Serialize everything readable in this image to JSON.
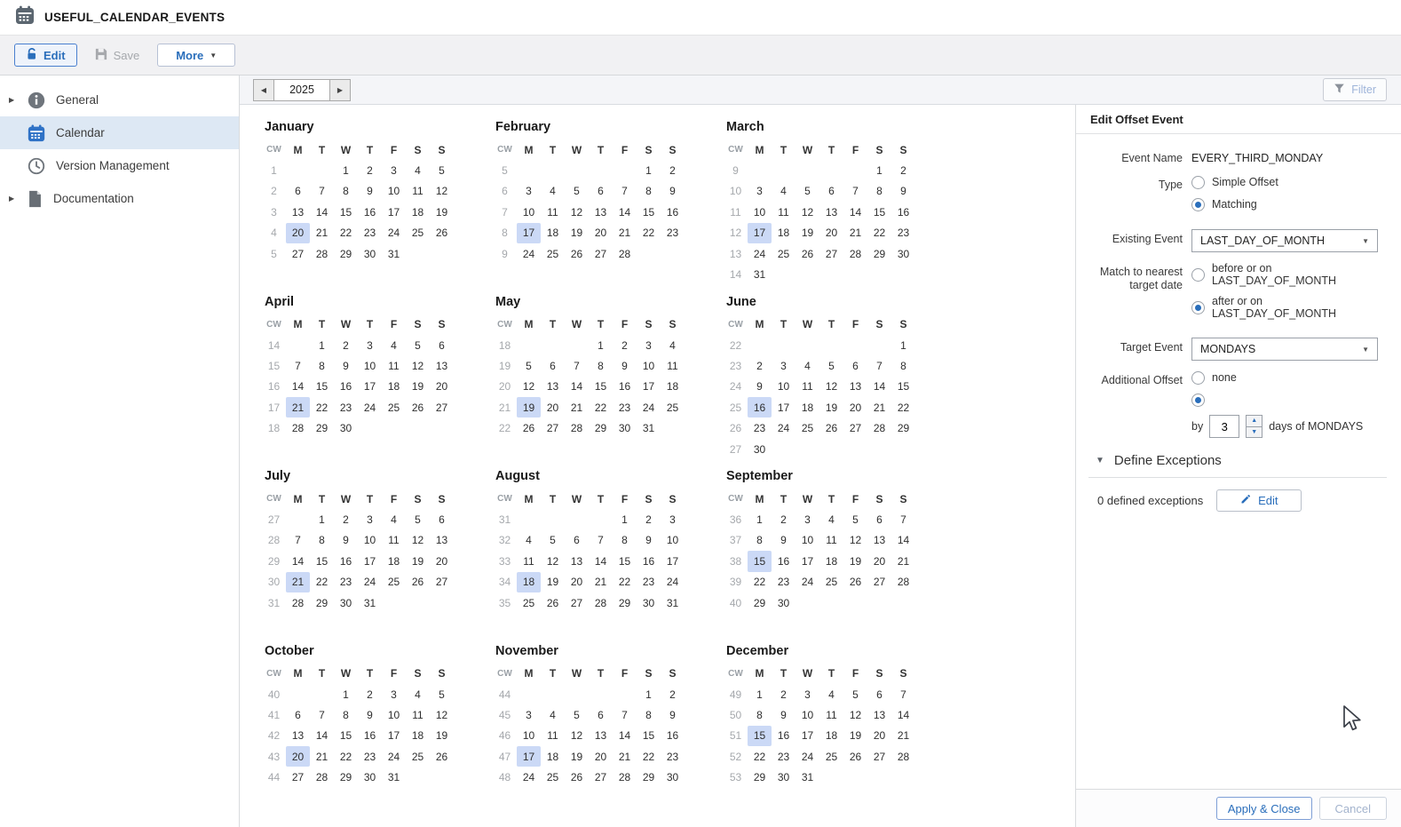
{
  "colors": {
    "accent": "#2a6ebb",
    "accent_border": "#4a80cf",
    "highlight": "#cbd9f6",
    "sidebar_selected": "#dde8f4"
  },
  "header": {
    "title": "USEFUL_CALENDAR_EVENTS"
  },
  "toolbar": {
    "edit": "Edit",
    "save": "Save",
    "more": "More"
  },
  "sidebar": {
    "items": [
      {
        "label": "General",
        "icon": "info-icon",
        "chevron": true,
        "selected": false
      },
      {
        "label": "Calendar",
        "icon": "calendar-icon",
        "chevron": false,
        "selected": true
      },
      {
        "label": "Version Management",
        "icon": "clock-icon",
        "chevron": false,
        "selected": false
      },
      {
        "label": "Documentation",
        "icon": "doc-icon",
        "chevron": true,
        "selected": false
      }
    ]
  },
  "main": {
    "year": "2025",
    "filter": "Filter"
  },
  "calendar": {
    "weekdays": [
      "CW",
      "M",
      "T",
      "W",
      "T",
      "F",
      "S",
      "S"
    ],
    "months": [
      {
        "name": "January",
        "highlight": 20,
        "weeks": [
          {
            "cw": 1,
            "days": [
              "",
              "",
              1,
              2,
              3,
              4,
              5
            ]
          },
          {
            "cw": 2,
            "days": [
              6,
              7,
              8,
              9,
              10,
              11,
              12
            ]
          },
          {
            "cw": 3,
            "days": [
              13,
              14,
              15,
              16,
              17,
              18,
              19
            ]
          },
          {
            "cw": 4,
            "days": [
              20,
              21,
              22,
              23,
              24,
              25,
              26
            ]
          },
          {
            "cw": 5,
            "days": [
              27,
              28,
              29,
              30,
              31,
              "",
              ""
            ]
          }
        ]
      },
      {
        "name": "February",
        "highlight": 17,
        "weeks": [
          {
            "cw": 5,
            "days": [
              "",
              "",
              "",
              "",
              "",
              1,
              2
            ]
          },
          {
            "cw": 6,
            "days": [
              3,
              4,
              5,
              6,
              7,
              8,
              9
            ]
          },
          {
            "cw": 7,
            "days": [
              10,
              11,
              12,
              13,
              14,
              15,
              16
            ]
          },
          {
            "cw": 8,
            "days": [
              17,
              18,
              19,
              20,
              21,
              22,
              23
            ]
          },
          {
            "cw": 9,
            "days": [
              24,
              25,
              26,
              27,
              28,
              "",
              ""
            ]
          }
        ]
      },
      {
        "name": "March",
        "highlight": 17,
        "weeks": [
          {
            "cw": 9,
            "days": [
              "",
              "",
              "",
              "",
              "",
              1,
              2
            ]
          },
          {
            "cw": 10,
            "days": [
              3,
              4,
              5,
              6,
              7,
              8,
              9
            ]
          },
          {
            "cw": 11,
            "days": [
              10,
              11,
              12,
              13,
              14,
              15,
              16
            ]
          },
          {
            "cw": 12,
            "days": [
              17,
              18,
              19,
              20,
              21,
              22,
              23
            ]
          },
          {
            "cw": 13,
            "days": [
              24,
              25,
              26,
              27,
              28,
              29,
              30
            ]
          },
          {
            "cw": 14,
            "days": [
              31,
              "",
              "",
              "",
              "",
              "",
              ""
            ]
          }
        ]
      },
      {
        "name": "April",
        "highlight": 21,
        "weeks": [
          {
            "cw": 14,
            "days": [
              "",
              1,
              2,
              3,
              4,
              5,
              6
            ]
          },
          {
            "cw": 15,
            "days": [
              7,
              8,
              9,
              10,
              11,
              12,
              13
            ]
          },
          {
            "cw": 16,
            "days": [
              14,
              15,
              16,
              17,
              18,
              19,
              20
            ]
          },
          {
            "cw": 17,
            "days": [
              21,
              22,
              23,
              24,
              25,
              26,
              27
            ]
          },
          {
            "cw": 18,
            "days": [
              28,
              29,
              30,
              "",
              "",
              "",
              ""
            ]
          }
        ]
      },
      {
        "name": "May",
        "highlight": 19,
        "weeks": [
          {
            "cw": 18,
            "days": [
              "",
              "",
              "",
              1,
              2,
              3,
              4
            ]
          },
          {
            "cw": 19,
            "days": [
              5,
              6,
              7,
              8,
              9,
              10,
              11
            ]
          },
          {
            "cw": 20,
            "days": [
              12,
              13,
              14,
              15,
              16,
              17,
              18
            ]
          },
          {
            "cw": 21,
            "days": [
              19,
              20,
              21,
              22,
              23,
              24,
              25
            ]
          },
          {
            "cw": 22,
            "days": [
              26,
              27,
              28,
              29,
              30,
              31,
              ""
            ]
          }
        ]
      },
      {
        "name": "June",
        "highlight": 16,
        "weeks": [
          {
            "cw": 22,
            "days": [
              "",
              "",
              "",
              "",
              "",
              "",
              1
            ]
          },
          {
            "cw": 23,
            "days": [
              2,
              3,
              4,
              5,
              6,
              7,
              8
            ]
          },
          {
            "cw": 24,
            "days": [
              9,
              10,
              11,
              12,
              13,
              14,
              15
            ]
          },
          {
            "cw": 25,
            "days": [
              16,
              17,
              18,
              19,
              20,
              21,
              22
            ]
          },
          {
            "cw": 26,
            "days": [
              23,
              24,
              25,
              26,
              27,
              28,
              29
            ]
          },
          {
            "cw": 27,
            "days": [
              30,
              "",
              "",
              "",
              "",
              "",
              ""
            ]
          }
        ]
      },
      {
        "name": "July",
        "highlight": 21,
        "weeks": [
          {
            "cw": 27,
            "days": [
              "",
              1,
              2,
              3,
              4,
              5,
              6
            ]
          },
          {
            "cw": 28,
            "days": [
              7,
              8,
              9,
              10,
              11,
              12,
              13
            ]
          },
          {
            "cw": 29,
            "days": [
              14,
              15,
              16,
              17,
              18,
              19,
              20
            ]
          },
          {
            "cw": 30,
            "days": [
              21,
              22,
              23,
              24,
              25,
              26,
              27
            ]
          },
          {
            "cw": 31,
            "days": [
              28,
              29,
              30,
              31,
              "",
              "",
              ""
            ]
          }
        ]
      },
      {
        "name": "August",
        "highlight": 18,
        "weeks": [
          {
            "cw": 31,
            "days": [
              "",
              "",
              "",
              "",
              1,
              2,
              3
            ]
          },
          {
            "cw": 32,
            "days": [
              4,
              5,
              6,
              7,
              8,
              9,
              10
            ]
          },
          {
            "cw": 33,
            "days": [
              11,
              12,
              13,
              14,
              15,
              16,
              17
            ]
          },
          {
            "cw": 34,
            "days": [
              18,
              19,
              20,
              21,
              22,
              23,
              24
            ]
          },
          {
            "cw": 35,
            "days": [
              25,
              26,
              27,
              28,
              29,
              30,
              31
            ]
          }
        ]
      },
      {
        "name": "September",
        "highlight": 15,
        "weeks": [
          {
            "cw": 36,
            "days": [
              1,
              2,
              3,
              4,
              5,
              6,
              7
            ]
          },
          {
            "cw": 37,
            "days": [
              8,
              9,
              10,
              11,
              12,
              13,
              14
            ]
          },
          {
            "cw": 38,
            "days": [
              15,
              16,
              17,
              18,
              19,
              20,
              21
            ]
          },
          {
            "cw": 39,
            "days": [
              22,
              23,
              24,
              25,
              26,
              27,
              28
            ]
          },
          {
            "cw": 40,
            "days": [
              29,
              30,
              "",
              "",
              "",
              "",
              ""
            ]
          }
        ]
      },
      {
        "name": "October",
        "highlight": 20,
        "weeks": [
          {
            "cw": 40,
            "days": [
              "",
              "",
              1,
              2,
              3,
              4,
              5
            ]
          },
          {
            "cw": 41,
            "days": [
              6,
              7,
              8,
              9,
              10,
              11,
              12
            ]
          },
          {
            "cw": 42,
            "days": [
              13,
              14,
              15,
              16,
              17,
              18,
              19
            ]
          },
          {
            "cw": 43,
            "days": [
              20,
              21,
              22,
              23,
              24,
              25,
              26
            ]
          },
          {
            "cw": 44,
            "days": [
              27,
              28,
              29,
              30,
              31,
              "",
              ""
            ]
          }
        ]
      },
      {
        "name": "November",
        "highlight": 17,
        "weeks": [
          {
            "cw": 44,
            "days": [
              "",
              "",
              "",
              "",
              "",
              1,
              2
            ]
          },
          {
            "cw": 45,
            "days": [
              3,
              4,
              5,
              6,
              7,
              8,
              9
            ]
          },
          {
            "cw": 46,
            "days": [
              10,
              11,
              12,
              13,
              14,
              15,
              16
            ]
          },
          {
            "cw": 47,
            "days": [
              17,
              18,
              19,
              20,
              21,
              22,
              23
            ]
          },
          {
            "cw": 48,
            "days": [
              24,
              25,
              26,
              27,
              28,
              29,
              30
            ]
          }
        ]
      },
      {
        "name": "December",
        "highlight": 15,
        "weeks": [
          {
            "cw": 49,
            "days": [
              1,
              2,
              3,
              4,
              5,
              6,
              7
            ]
          },
          {
            "cw": 50,
            "days": [
              8,
              9,
              10,
              11,
              12,
              13,
              14
            ]
          },
          {
            "cw": 51,
            "days": [
              15,
              16,
              17,
              18,
              19,
              20,
              21
            ]
          },
          {
            "cw": 52,
            "days": [
              22,
              23,
              24,
              25,
              26,
              27,
              28
            ]
          },
          {
            "cw": 53,
            "days": [
              29,
              30,
              31,
              "",
              "",
              "",
              ""
            ]
          }
        ]
      }
    ]
  },
  "panel": {
    "title": "Edit Offset Event",
    "fields": {
      "event_name": {
        "label": "Event Name",
        "value": "EVERY_THIRD_MONDAY"
      },
      "type": {
        "label": "Type",
        "options": [
          {
            "label": "Simple Offset",
            "selected": false
          },
          {
            "label": "Matching",
            "selected": true
          }
        ]
      },
      "existing_event": {
        "label": "Existing Event",
        "value": "LAST_DAY_OF_MONTH"
      },
      "match": {
        "label": "Match to nearest target date",
        "options": [
          {
            "label": "before or on LAST_DAY_OF_MONTH",
            "selected": false
          },
          {
            "label": "after or on LAST_DAY_OF_MONTH",
            "selected": true
          }
        ]
      },
      "target_event": {
        "label": "Target Event",
        "value": "MONDAYS"
      },
      "additional": {
        "label": "Additional Offset",
        "none": {
          "label": "none",
          "selected": false
        },
        "custom": {
          "selected": true
        },
        "by_label": "by",
        "value": "3",
        "suffix": "days of MONDAYS"
      }
    },
    "exceptions": {
      "title": "Define Exceptions",
      "count": "0 defined exceptions",
      "edit": "Edit"
    },
    "footer": {
      "apply": "Apply & Close",
      "cancel": "Cancel"
    }
  }
}
